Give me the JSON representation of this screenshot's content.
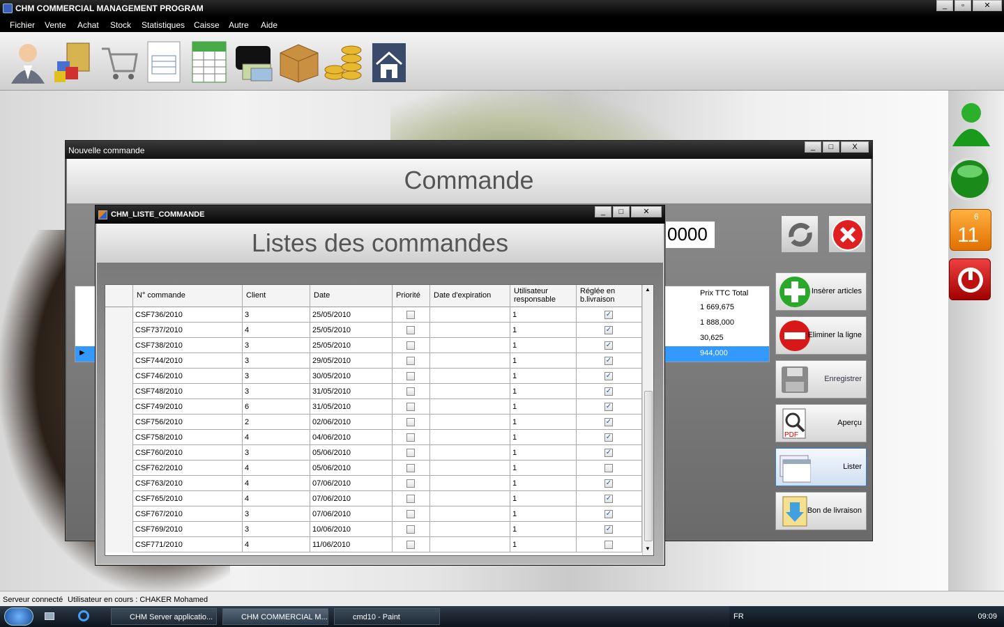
{
  "app": {
    "title": "CHM COMMERCIAL MANAGEMENT PROGRAM"
  },
  "menu": [
    "Fichier",
    "Vente",
    "Achat",
    "Stock",
    "Statistiques",
    "Caisse",
    "Autre",
    "Aide"
  ],
  "toolbar_icons": [
    "user-icon",
    "products-icon",
    "cart-icon",
    "invoice-icon",
    "spreadsheet-icon",
    "wallet-icon",
    "package-icon",
    "coins-icon",
    "home-icon"
  ],
  "commande_window": {
    "title": "Nouvelle commande",
    "header": "Commande",
    "number_display": "0000",
    "grid_header": "Prix TTC Total",
    "grid_values": [
      "1 669,675",
      "1 888,000",
      "30,625",
      "944,000"
    ],
    "buttons": {
      "insert": "Insèrer articles",
      "delete": "Eliminer la ligne",
      "save": "Enregistrer",
      "preview": "Aperçu",
      "list": "Lister",
      "delivery": "Bon de livraison"
    }
  },
  "liste_window": {
    "title": "CHM_LISTE_COMMANDE",
    "header": "Listes des commandes",
    "columns": [
      "N° commande",
      "Client",
      "Date",
      "Priorité",
      "Date d'expiration",
      "Utilisateur responsable",
      "Réglée en b.livraison"
    ],
    "rows": [
      {
        "num": "CSF736/2010",
        "client": "3",
        "date": "25/05/2010",
        "user": "1",
        "paid": true
      },
      {
        "num": "CSF737/2010",
        "client": "4",
        "date": "25/05/2010",
        "user": "1",
        "paid": true
      },
      {
        "num": "CSF738/2010",
        "client": "3",
        "date": "25/05/2010",
        "user": "1",
        "paid": true
      },
      {
        "num": "CSF744/2010",
        "client": "3",
        "date": "29/05/2010",
        "user": "1",
        "paid": true
      },
      {
        "num": "CSF746/2010",
        "client": "3",
        "date": "30/05/2010",
        "user": "1",
        "paid": true
      },
      {
        "num": "CSF748/2010",
        "client": "3",
        "date": "31/05/2010",
        "user": "1",
        "paid": true
      },
      {
        "num": "CSF749/2010",
        "client": "6",
        "date": "31/05/2010",
        "user": "1",
        "paid": true
      },
      {
        "num": "CSF756/2010",
        "client": "2",
        "date": "02/06/2010",
        "user": "1",
        "paid": true
      },
      {
        "num": "CSF758/2010",
        "client": "4",
        "date": "04/06/2010",
        "user": "1",
        "paid": true
      },
      {
        "num": "CSF760/2010",
        "client": "3",
        "date": "05/06/2010",
        "user": "1",
        "paid": true
      },
      {
        "num": "CSF762/2010",
        "client": "4",
        "date": "05/06/2010",
        "user": "1",
        "paid": false
      },
      {
        "num": "CSF763/2010",
        "client": "4",
        "date": "07/06/2010",
        "user": "1",
        "paid": true
      },
      {
        "num": "CSF765/2010",
        "client": "4",
        "date": "07/06/2010",
        "user": "1",
        "paid": true
      },
      {
        "num": "CSF767/2010",
        "client": "3",
        "date": "07/06/2010",
        "user": "1",
        "paid": true
      },
      {
        "num": "CSF769/2010",
        "client": "3",
        "date": "10/06/2010",
        "user": "1",
        "paid": true
      },
      {
        "num": "CSF771/2010",
        "client": "4",
        "date": "11/06/2010",
        "user": "1",
        "paid": false
      }
    ]
  },
  "side": {
    "calendar_day": "11",
    "calendar_month": "6"
  },
  "status": {
    "server": "Serveur connecté",
    "user": "Utilisateur en cours : CHAKER Mohamed"
  },
  "taskbar": {
    "tasks": [
      "CHM Server applicatio...",
      "CHM COMMERCIAL M...",
      "cmd10 - Paint"
    ],
    "lang": "FR",
    "clock": "09:09"
  },
  "colors": {
    "selected_row": "#3399ff",
    "window_dark": "#111111"
  }
}
